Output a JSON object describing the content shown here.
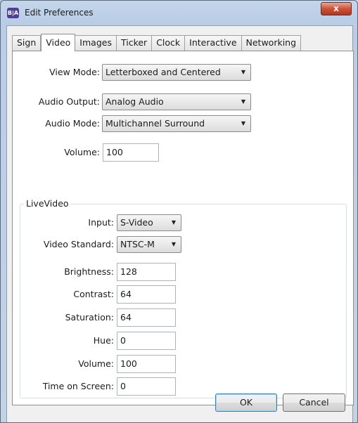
{
  "window": {
    "title": "Edit Preferences",
    "app_icon_text": "B|A",
    "close_label": "x"
  },
  "tabs": [
    {
      "label": "Sign",
      "active": false
    },
    {
      "label": "Video",
      "active": true
    },
    {
      "label": "Images",
      "active": false
    },
    {
      "label": "Ticker",
      "active": false
    },
    {
      "label": "Clock",
      "active": false
    },
    {
      "label": "Interactive",
      "active": false
    },
    {
      "label": "Networking",
      "active": false
    }
  ],
  "video": {
    "view_mode": {
      "label": "View Mode:",
      "value": "Letterboxed and Centered"
    },
    "audio_output": {
      "label": "Audio Output:",
      "value": "Analog Audio"
    },
    "audio_mode": {
      "label": "Audio Mode:",
      "value": "Multichannel Surround"
    },
    "volume": {
      "label": "Volume:",
      "value": "100"
    }
  },
  "live_video": {
    "group_label": "LiveVideo",
    "input": {
      "label": "Input:",
      "value": "S-Video"
    },
    "video_standard": {
      "label": "Video Standard:",
      "value": "NTSC-M"
    },
    "brightness": {
      "label": "Brightness:",
      "value": "128"
    },
    "contrast": {
      "label": "Contrast:",
      "value": "64"
    },
    "saturation": {
      "label": "Saturation:",
      "value": "64"
    },
    "hue": {
      "label": "Hue:",
      "value": "0"
    },
    "volume": {
      "label": "Volume:",
      "value": "100"
    },
    "time_on_screen": {
      "label": "Time on Screen:",
      "value": "0"
    }
  },
  "buttons": {
    "ok": "OK",
    "cancel": "Cancel"
  },
  "icons": {
    "dropdown_arrow": "▼"
  }
}
